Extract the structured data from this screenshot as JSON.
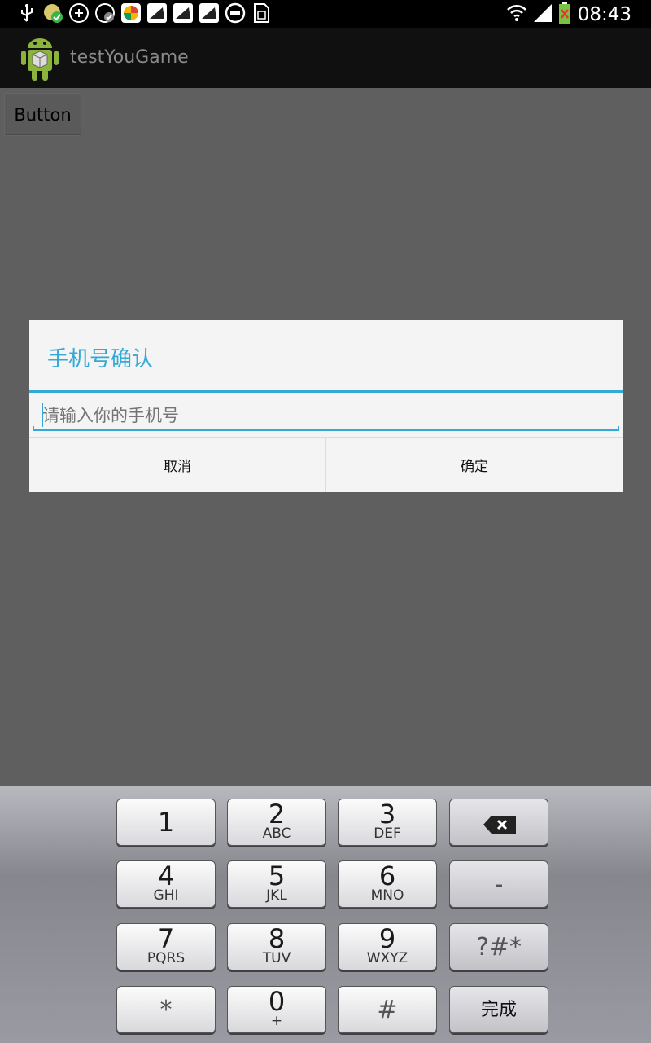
{
  "status_bar": {
    "time": "08:43",
    "icons": [
      "usb-icon",
      "app-notify-icon",
      "bubble-icon",
      "bubble-check-icon",
      "colorful-app-icon",
      "bird-icon",
      "bird-icon",
      "bird-icon",
      "do-not-disturb-icon",
      "sim-card-icon",
      "wifi-icon",
      "signal-icon",
      "battery-icon"
    ]
  },
  "action_bar": {
    "title": "testYouGame"
  },
  "content": {
    "button_label": "Button"
  },
  "dialog": {
    "title": "手机号确认",
    "input_placeholder": "请输入你的手机号",
    "cancel_label": "取消",
    "confirm_label": "确定"
  },
  "keypad": {
    "keys": [
      {
        "num": "1",
        "sub": ""
      },
      {
        "num": "2",
        "sub": "ABC"
      },
      {
        "num": "3",
        "sub": "DEF"
      },
      {
        "num": "4",
        "sub": "GHI"
      },
      {
        "num": "5",
        "sub": "JKL"
      },
      {
        "num": "6",
        "sub": "MNO"
      },
      {
        "num": "7",
        "sub": "PQRS"
      },
      {
        "num": "8",
        "sub": "TUV"
      },
      {
        "num": "9",
        "sub": "WXYZ"
      },
      {
        "num": "*",
        "sub": ""
      },
      {
        "num": "0",
        "sub": "+"
      },
      {
        "num": "#",
        "sub": ""
      }
    ],
    "dash_label": "-",
    "symbols_label": "?#*",
    "done_label": "完成"
  },
  "colors": {
    "accent": "#33a9d8",
    "dialog_bg": "#f4f4f4",
    "background": "#5f5f5f"
  }
}
